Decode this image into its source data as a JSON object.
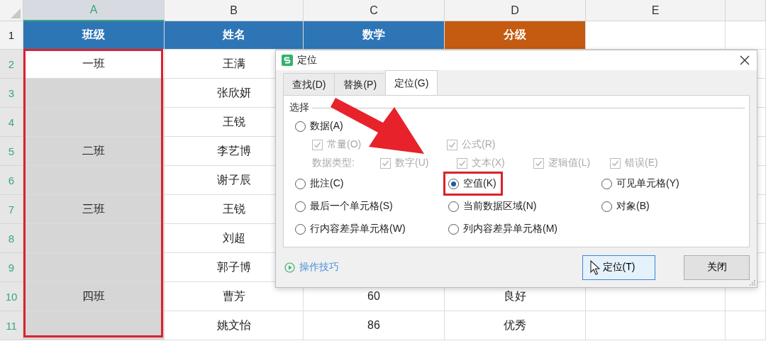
{
  "columns": [
    {
      "label": "A",
      "selected": true,
      "outlined": true
    },
    {
      "label": "B",
      "selected": false,
      "outlined": false
    },
    {
      "label": "C",
      "selected": false,
      "outlined": false
    },
    {
      "label": "D",
      "selected": false,
      "outlined": false
    },
    {
      "label": "E",
      "selected": false,
      "outlined": false
    }
  ],
  "header_row": {
    "number": "1",
    "selected": false,
    "cells": [
      {
        "text": "班级",
        "color": "#2e75b6"
      },
      {
        "text": "姓名",
        "color": "#2e75b6"
      },
      {
        "text": "数学",
        "color": "#2e75b6"
      },
      {
        "text": "分级",
        "color": "#c55a11"
      }
    ]
  },
  "rows": [
    {
      "number": "2",
      "selected": true,
      "class_cell": {
        "text": "一班",
        "selected": false
      },
      "name": "王满"
    },
    {
      "number": "3",
      "selected": true,
      "class_cell": {
        "selected": true
      },
      "name": "张欣妍"
    },
    {
      "number": "4",
      "selected": true,
      "class_cell": {
        "selected": true
      },
      "name": "王锐"
    },
    {
      "number": "5",
      "selected": true,
      "class_cell": {
        "text": "二班",
        "selected": true
      },
      "name": "李艺博"
    },
    {
      "number": "6",
      "selected": true,
      "class_cell": {
        "selected": true
      },
      "name": "谢子辰"
    },
    {
      "number": "7",
      "selected": true,
      "class_cell": {
        "text": "三班",
        "selected": true
      },
      "name": "王锐"
    },
    {
      "number": "8",
      "selected": true,
      "class_cell": {
        "selected": true
      },
      "name": "刘超"
    },
    {
      "number": "9",
      "selected": true,
      "class_cell": {
        "selected": true
      },
      "name": "郭子博"
    },
    {
      "number": "10",
      "selected": true,
      "class_cell": {
        "text": "四班",
        "selected": true
      },
      "name": "曹芳",
      "score": "60",
      "grade": "良好"
    },
    {
      "number": "11",
      "selected": true,
      "class_cell": {
        "selected": true
      },
      "name": "姚文怡",
      "score": "86",
      "grade": "优秀"
    }
  ],
  "dialog": {
    "title": "定位",
    "tabs": [
      {
        "label": "查找(D)",
        "selected": false
      },
      {
        "label": "替换(P)",
        "selected": false
      },
      {
        "label": "定位(G)",
        "selected": true
      }
    ],
    "group_label": "选择",
    "data_radio": {
      "label": "数据(A)",
      "checked": false
    },
    "constant_checks": [
      {
        "label": "常量(O)",
        "checked": true,
        "disabled": true
      },
      {
        "label": "公式(R)",
        "checked": true,
        "disabled": true
      }
    ],
    "type_label": "数据类型:",
    "type_checks": [
      {
        "label": "数字(U)",
        "checked": true,
        "disabled": true
      },
      {
        "label": "文本(X)",
        "checked": true,
        "disabled": true
      },
      {
        "label": "逻辑值(L)",
        "checked": true,
        "disabled": true
      },
      {
        "label": "错误(E)",
        "checked": true,
        "disabled": true
      }
    ],
    "radios": [
      {
        "label": "批注(C)",
        "checked": false,
        "outlined": false
      },
      {
        "label": "空值(K)",
        "checked": true,
        "outlined": true
      },
      {
        "label": "可见单元格(Y)",
        "checked": false,
        "outlined": false
      },
      {
        "label": "最后一个单元格(S)",
        "checked": false,
        "outlined": false
      },
      {
        "label": "当前数据区域(N)",
        "checked": false,
        "outlined": false
      },
      {
        "label": "对象(B)",
        "checked": false,
        "outlined": false
      },
      {
        "label": "行内容差异单元格(W)",
        "checked": false,
        "outlined": false
      },
      {
        "label": "列内容差异单元格(M)",
        "checked": false,
        "outlined": false
      }
    ],
    "tips_link": "操作技巧",
    "buttons": [
      {
        "label": "定位(T)",
        "focused": true
      },
      {
        "label": "关闭",
        "focused": false
      }
    ]
  }
}
